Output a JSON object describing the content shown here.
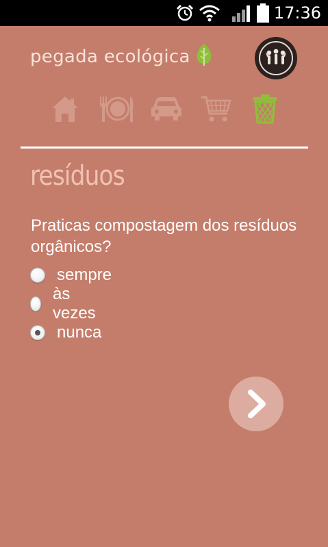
{
  "status_bar": {
    "time": "17:36",
    "icons": [
      "alarm-icon",
      "wifi-icon",
      "signal-icon",
      "battery-icon"
    ]
  },
  "header": {
    "app_name": "pegada ecológica",
    "leaf_icon": "leaf-icon",
    "avatar_icon": "people-group-icon"
  },
  "categories": [
    {
      "name": "casa",
      "icon": "house-icon",
      "active": false
    },
    {
      "name": "alimentação",
      "icon": "plate-cutlery-icon",
      "active": false
    },
    {
      "name": "transportes",
      "icon": "car-icon",
      "active": false
    },
    {
      "name": "compras",
      "icon": "cart-icon",
      "active": false
    },
    {
      "name": "resíduos",
      "icon": "trash-bin-icon",
      "active": true
    }
  ],
  "section": {
    "title": "resíduos"
  },
  "question": {
    "text": "Praticas compostagem dos resíduos orgânicos?",
    "options": [
      {
        "label": "sempre",
        "selected": false
      },
      {
        "label": "às vezes",
        "selected": false
      },
      {
        "label": "nunca",
        "selected": true
      }
    ]
  },
  "next_button": {
    "icon": "chevron-right-icon"
  },
  "colors": {
    "background": "#c47d6b",
    "icon_inactive": "#d39a8a",
    "icon_active": "#8fbf3a",
    "title": "#f0c2b2",
    "next_button": "#dcaca0"
  }
}
